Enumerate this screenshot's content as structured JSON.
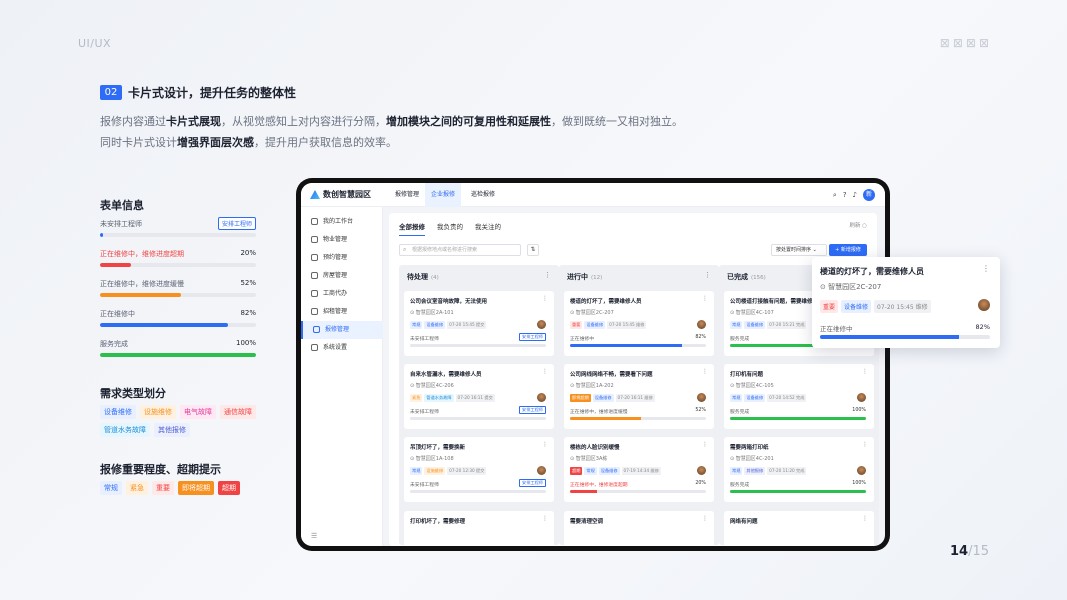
{
  "header": {
    "top_label": "UI/UX",
    "section_no": "02",
    "section_title": "卡片式设计，提升任务的整体性",
    "desc1_a": "报修内容通过",
    "desc1_b": "卡片式展现",
    "desc1_c": "，从视觉感知上对内容进行分隔，",
    "desc1_d": "增加模块之间的可复用性和延展性",
    "desc1_e": "，做到既统一又相对独立。",
    "desc2_a": "同时卡片式设计",
    "desc2_b": "增强界面层次感",
    "desc2_c": "，提升用户获取信息的效率。"
  },
  "form": {
    "title": "表单信息",
    "rows": [
      {
        "label": "未安排工程师",
        "badge": "安排工程师",
        "progress": 0.02,
        "color": "#2e6cf6"
      },
      {
        "label": "正在维修中，维修进度超期",
        "value": "20%",
        "progress": 0.2,
        "color": "#f04444",
        "label_color": "#f04444"
      },
      {
        "label": "正在维修中，维修进度缓慢",
        "value": "52%",
        "progress": 0.52,
        "color": "#f7901e"
      },
      {
        "label": "正在维修中",
        "value": "82%",
        "progress": 0.82,
        "color": "#2e6cf6"
      },
      {
        "label": "服务完成",
        "value": "100%",
        "progress": 1.0,
        "color": "#2bbf4d"
      }
    ]
  },
  "types": {
    "title": "需求类型划分",
    "tags": [
      "设备维修",
      "设施维修",
      "电气故障",
      "通信故障",
      "管道水务故障",
      "其他报修"
    ]
  },
  "levels": {
    "title": "报修重要程度、超期提示",
    "tags": [
      "常规",
      "紧急",
      "重要",
      "即将超期",
      "超期"
    ]
  },
  "app": {
    "name": "数创智慧园区",
    "nav": [
      "报修管理",
      "企业报修",
      "巡检报修"
    ],
    "avatar": "新",
    "sidebar": [
      "我的工作台",
      "物业管理",
      "预约管理",
      "房屋管理",
      "工商代办",
      "招租管理",
      "报修管理",
      "系统设置"
    ],
    "tabs": [
      "全部报修",
      "我负责的",
      "我关注的"
    ],
    "refresh": "刷新 ○",
    "search_placeholder": "根据报修地点或名称进行搜索",
    "sort": "按处置时间排序",
    "new_button": "+ 新增报修",
    "columns": [
      {
        "title": "待处理",
        "count": "(4)",
        "cards": [
          {
            "title": "公司会议室音响故障，无法使用",
            "loc": "智慧园区2A-101",
            "tags": [
              "常规",
              "设备维修",
              "07-20 15:45 提交"
            ],
            "status": "未安排工程师",
            "badge": "安排工程师",
            "progress": 0.0
          },
          {
            "title": "自来水管漏水，需要维修人员",
            "loc": "智慧园区4C-206",
            "tags": [
              "紧急",
              "管道水务故障",
              "07-20 16:11 提交"
            ],
            "status": "未安排工程师",
            "badge": "安排工程师",
            "progress": 0.0
          },
          {
            "title": "吊顶灯坏了，需要换新",
            "loc": "智慧园区1A-108",
            "tags": [
              "常规",
              "设施维修",
              "07-20 12:30 提交"
            ],
            "status": "未安排工程师",
            "badge": "安排工程师",
            "progress": 0.0
          },
          {
            "title": "打印机坏了，需要修理"
          }
        ]
      },
      {
        "title": "进行中",
        "count": "(12)",
        "cards": [
          {
            "title": "楼道的灯坏了，需要维修人员",
            "loc": "智慧园区2C-207",
            "tags": [
              "重要",
              "设备维修",
              "07-20 15:45 维修"
            ],
            "status": "正在维修中",
            "value": "82%",
            "progress": 0.82,
            "color": "#2e6cf6"
          },
          {
            "title": "公司网线网络不畅，需要看下问题",
            "loc": "智慧园区1A-202",
            "tags": [
              "即将超期",
              "设备维修",
              "07-20 16:11 维修"
            ],
            "status": "正在维修中，维修进度缓慢",
            "value": "52%",
            "progress": 0.52,
            "color": "#f7901e"
          },
          {
            "title": "楼栋的人脸识别缓慢",
            "loc": "智慧园区3A栋",
            "tags": [
              "超期",
              "常规",
              "设备维修",
              "07-19 14:34 维修"
            ],
            "status": "正在维修中，维修进度超期",
            "value": "20%",
            "progress": 0.2,
            "color": "#f04444"
          },
          {
            "title": "需要清理空调"
          }
        ]
      },
      {
        "title": "已完成",
        "count": "(156)",
        "cards": [
          {
            "title": "公司楼道打接触有问题，需要维修",
            "loc": "智慧园区4C-107",
            "tags": [
              "常规",
              "设备维修",
              "07-20 15:21 完成"
            ],
            "status": "服务完成",
            "value": "100%",
            "progress": 1.0,
            "color": "#2bbf4d"
          },
          {
            "title": "打印机有问题",
            "loc": "智慧园区4C-105",
            "tags": [
              "常规",
              "设备维修",
              "07-20 14:52 完成"
            ],
            "status": "服务完成",
            "value": "100%",
            "progress": 1.0,
            "color": "#2bbf4d"
          },
          {
            "title": "需要两箱打印纸",
            "loc": "智慧园区4C-201",
            "tags": [
              "常规",
              "其他报修",
              "07-20 11:20 完成"
            ],
            "status": "服务完成",
            "value": "100%",
            "progress": 1.0,
            "color": "#2bbf4d"
          },
          {
            "title": "网络有问题"
          }
        ]
      }
    ]
  },
  "popup": {
    "title": "楼道的灯坏了，需要维修人员",
    "loc": "智慧园区2C-207",
    "tags": [
      "重要",
      "设备维修",
      "07-20 15:45 维修"
    ],
    "status": "正在维修中",
    "value": "82%",
    "progress": 0.82
  },
  "page": {
    "current": "14",
    "total": "/15"
  },
  "tag_colors": {
    "设备维修": [
      "#e8f0ff",
      "#2e6cf6"
    ],
    "设施维修": [
      "#fff1e0",
      "#f7901e"
    ],
    "电气故障": [
      "#ffe8f3",
      "#e0399a"
    ],
    "通信故障": [
      "#ffe8e8",
      "#f04444"
    ],
    "管道水务故障": [
      "#e6f6ff",
      "#1a8bd6"
    ],
    "其他报修": [
      "#eceffd",
      "#4a5ccf"
    ],
    "常规": [
      "#e8f0ff",
      "#2e6cf6"
    ],
    "紧急": [
      "#fff1e0",
      "#f7901e"
    ],
    "重要": [
      "#ffe8e8",
      "#f04444"
    ],
    "即将超期": [
      "#f7901e",
      "#ffffff"
    ],
    "超期": [
      "#f04444",
      "#ffffff"
    ]
  }
}
